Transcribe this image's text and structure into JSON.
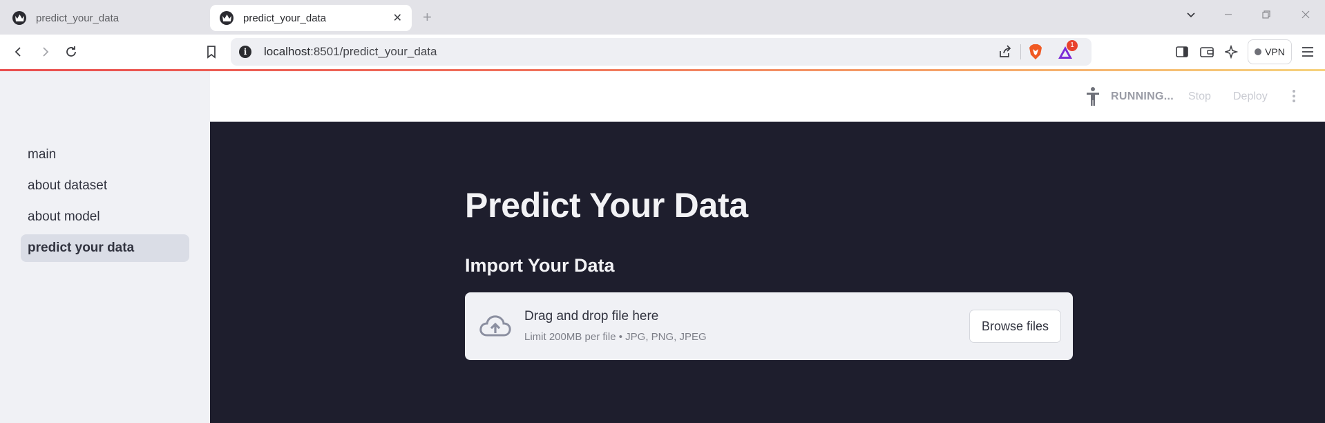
{
  "browser": {
    "tabs": [
      {
        "title": "predict_your_data",
        "active": false
      },
      {
        "title": "predict_your_data",
        "active": true
      }
    ],
    "new_tab_label": "+",
    "close_tab_label": "✕",
    "address": {
      "host": "localhost",
      "path": ":8501/predict_your_data"
    },
    "notification_count": "1",
    "vpn_label": "VPN"
  },
  "sidebar": {
    "items": [
      {
        "label": "main",
        "selected": false
      },
      {
        "label": "about dataset",
        "selected": false
      },
      {
        "label": "about model",
        "selected": false
      },
      {
        "label": "predict your data",
        "selected": true
      }
    ]
  },
  "app_header": {
    "status": "RUNNING...",
    "stop_label": "Stop",
    "deploy_label": "Deploy"
  },
  "main": {
    "title": "Predict Your Data",
    "subtitle": "Import Your Data",
    "uploader": {
      "primary_text": "Drag and drop file here",
      "limit_text": "Limit 200MB per file • JPG, PNG, JPEG",
      "button_label": "Browse files"
    }
  },
  "colors": {
    "main_background": "#1e1e2d",
    "sidebar_background": "#f0f1f5",
    "selected_item": "#dadde6",
    "progress_gradient_start": "#e94e4e",
    "progress_gradient_end": "#f6d27c"
  }
}
